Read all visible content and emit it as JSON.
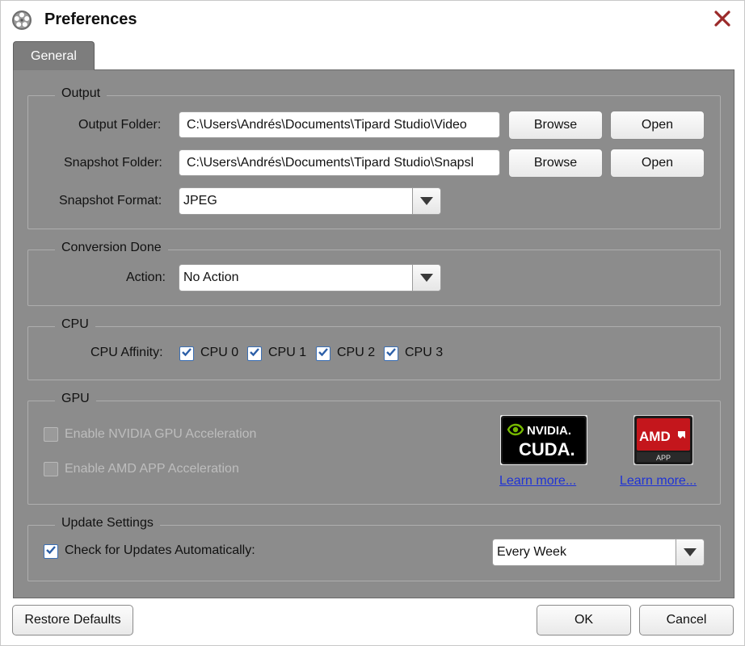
{
  "window": {
    "title": "Preferences"
  },
  "tabs": [
    {
      "label": "General"
    }
  ],
  "output": {
    "title": "Output",
    "output_folder_label": "Output Folder:",
    "output_folder_value": "C:\\Users\\Andrés\\Documents\\Tipard Studio\\Video",
    "snapshot_folder_label": "Snapshot Folder:",
    "snapshot_folder_value": "C:\\Users\\Andrés\\Documents\\Tipard Studio\\Snapsl",
    "browse_label": "Browse",
    "open_label": "Open",
    "snapshot_format_label": "Snapshot Format:",
    "snapshot_format_value": "JPEG"
  },
  "conversion": {
    "title": "Conversion Done",
    "action_label": "Action:",
    "action_value": "No Action"
  },
  "cpu": {
    "title": "CPU",
    "affinity_label": "CPU Affinity:",
    "cores": [
      {
        "label": "CPU 0",
        "checked": true
      },
      {
        "label": "CPU 1",
        "checked": true
      },
      {
        "label": "CPU 2",
        "checked": true
      },
      {
        "label": "CPU 3",
        "checked": true
      }
    ]
  },
  "gpu": {
    "title": "GPU",
    "nvidia_label": "Enable NVIDIA GPU Acceleration",
    "amd_label": "Enable AMD APP Acceleration",
    "nvidia_badge_top": "NVIDIA.",
    "nvidia_badge_bottom": "CUDA.",
    "amd_badge_top": "AMD",
    "amd_badge_bottom": "APP",
    "learn_more_label": "Learn more..."
  },
  "update": {
    "title": "Update Settings",
    "check_label": "Check for Updates Automatically:",
    "checked": true,
    "frequency_value": "Every Week"
  },
  "footer": {
    "restore_label": "Restore Defaults",
    "ok_label": "OK",
    "cancel_label": "Cancel"
  },
  "colors": {
    "panel_bg": "#8c8c8c",
    "tab_bg": "#7d7d7d",
    "checkbox_blue": "#2c5fa8",
    "link_blue": "#1f33d6",
    "close_red": "#9b2a2a",
    "nvidia_green": "#76b900",
    "amd_red": "#c4161c"
  },
  "icons": {
    "app": "film-reel-icon",
    "close": "close-x-icon",
    "dropdown": "triangle-down-icon",
    "check": "check-mark-icon"
  }
}
